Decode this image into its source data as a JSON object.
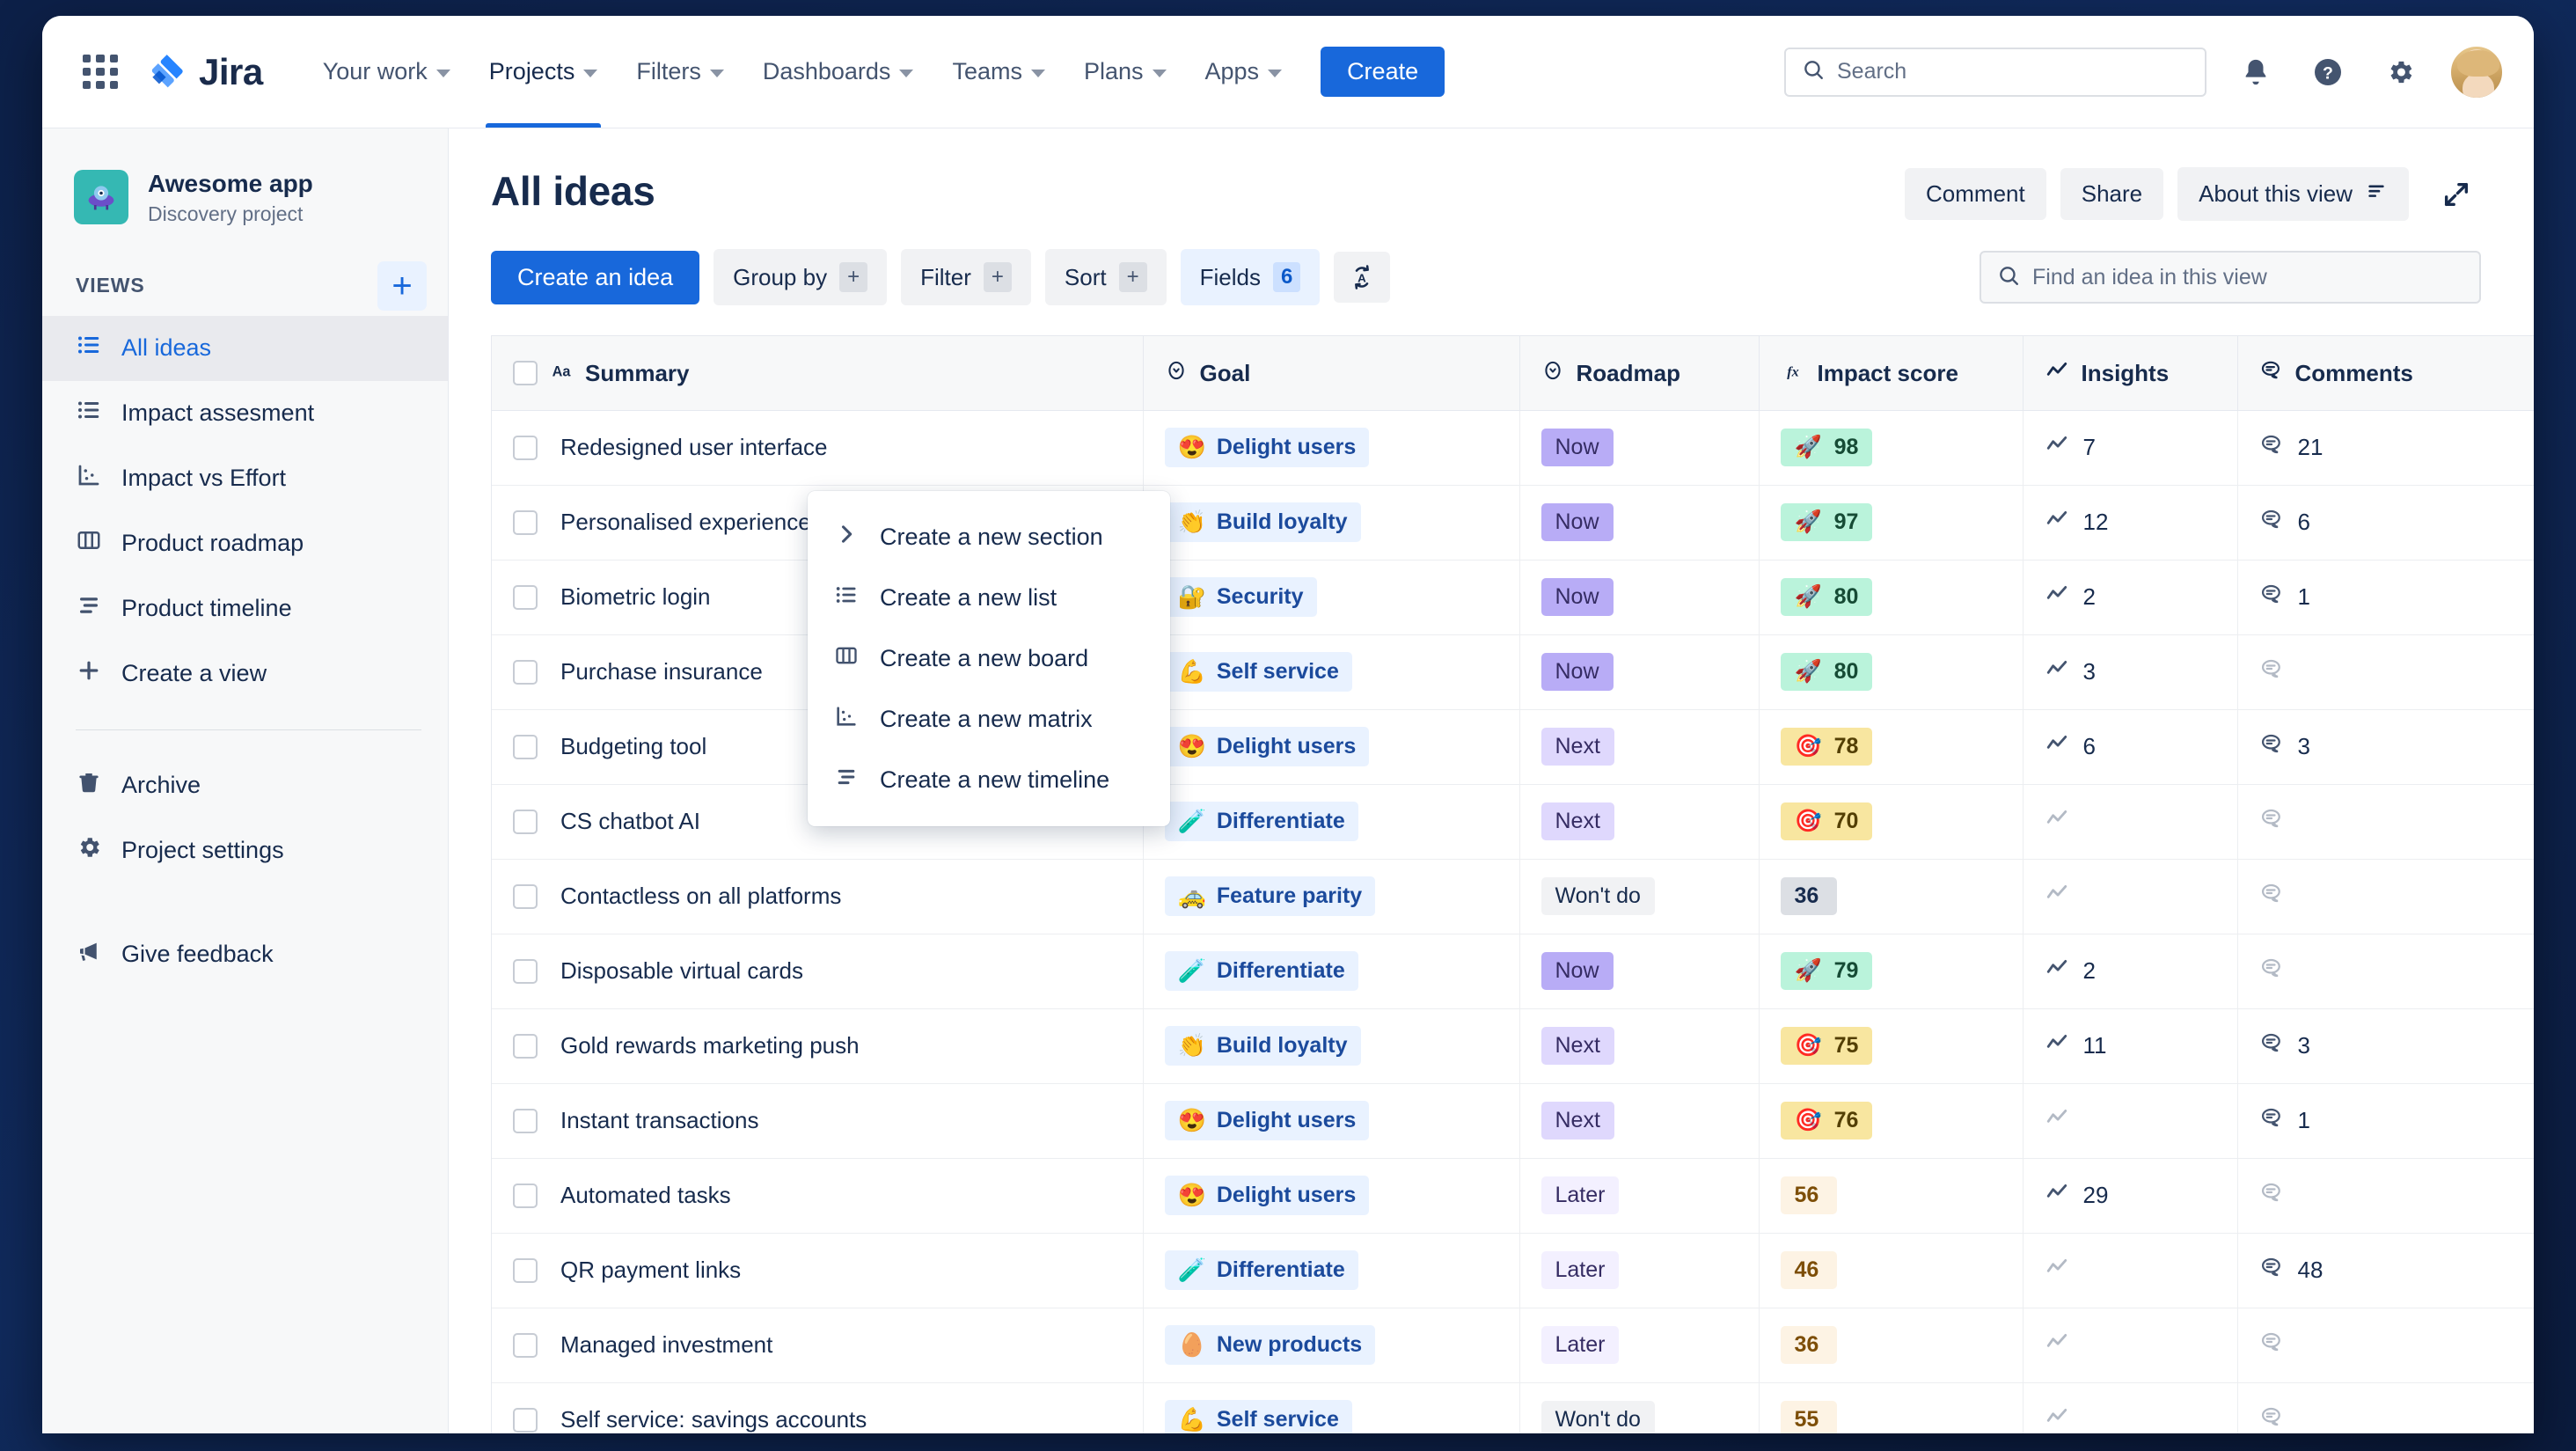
{
  "topnav": {
    "brand": "Jira",
    "items": [
      {
        "label": "Your work",
        "has_caret": true,
        "active": false
      },
      {
        "label": "Projects",
        "has_caret": true,
        "active": true
      },
      {
        "label": "Filters",
        "has_caret": true,
        "active": false
      },
      {
        "label": "Dashboards",
        "has_caret": true,
        "active": false
      },
      {
        "label": "Teams",
        "has_caret": true,
        "active": false
      },
      {
        "label": "Plans",
        "has_caret": true,
        "active": false
      },
      {
        "label": "Apps",
        "has_caret": true,
        "active": false
      }
    ],
    "create_label": "Create",
    "search_placeholder": "Search",
    "icons": [
      "app-switcher-icon",
      "search-icon",
      "notifications-icon",
      "help-icon",
      "settings-icon",
      "avatar"
    ]
  },
  "sidebar": {
    "project_name": "Awesome app",
    "project_type": "Discovery project",
    "section_label": "VIEWS",
    "add_view_label": "+",
    "views": [
      {
        "label": "All ideas",
        "icon": "list-icon",
        "selected": true
      },
      {
        "label": "Impact assesment",
        "icon": "list-icon",
        "selected": false
      },
      {
        "label": "Impact vs Effort",
        "icon": "matrix-icon",
        "selected": false
      },
      {
        "label": "Product roadmap",
        "icon": "board-icon",
        "selected": false
      },
      {
        "label": "Product timeline",
        "icon": "timeline-icon",
        "selected": false
      },
      {
        "label": "Create a view",
        "icon": "plus-icon",
        "selected": false
      }
    ],
    "footer": [
      {
        "label": "Archive",
        "icon": "trash-icon"
      },
      {
        "label": "Project settings",
        "icon": "gear-icon"
      },
      {
        "label": "Give feedback",
        "icon": "megaphone-icon"
      }
    ]
  },
  "popup": {
    "items": [
      {
        "label": "Create a new section",
        "icon": "chevron-right-icon"
      },
      {
        "label": "Create a new list",
        "icon": "list-icon"
      },
      {
        "label": "Create a new board",
        "icon": "board-icon"
      },
      {
        "label": "Create a new matrix",
        "icon": "matrix-icon"
      },
      {
        "label": "Create a new timeline",
        "icon": "timeline-icon"
      }
    ]
  },
  "main": {
    "title": "All ideas",
    "header_actions": [
      {
        "label": "Comment",
        "icon": null
      },
      {
        "label": "Share",
        "icon": null
      },
      {
        "label": "About this view",
        "icon": "detail-lines-icon"
      }
    ],
    "expand_icon": "expand-icon",
    "toolbar": {
      "create_idea": "Create an idea",
      "group_by": "Group by",
      "group_by_badge": "+",
      "filter": "Filter",
      "filter_badge": "+",
      "sort": "Sort",
      "sort_badge": "+",
      "fields": "Fields",
      "fields_badge": "6",
      "autosort_icon": "auto-sort-a-icon",
      "find_placeholder": "Find an idea in this view"
    },
    "table": {
      "columns": [
        {
          "label": "Summary",
          "icon": "text-field-icon"
        },
        {
          "label": "Goal",
          "icon": "select-field-icon"
        },
        {
          "label": "Roadmap",
          "icon": "select-field-icon"
        },
        {
          "label": "Impact score",
          "icon": "formula-icon"
        },
        {
          "label": "Insights",
          "icon": "insights-icon"
        },
        {
          "label": "Comments",
          "icon": "comment-icon"
        }
      ],
      "add_column_label": "+",
      "rows": [
        {
          "summary": "Redesigned user interface",
          "summary_visible": "user interface",
          "goal": "Delight users",
          "goal_emoji": "😍",
          "roadmap": "Now",
          "roadmap_style": "now",
          "score": "98",
          "score_style": "green",
          "score_emoji": "🚀",
          "insights": "7",
          "comments": "21"
        },
        {
          "summary": "Personalised experiences",
          "summary_visible": "experiences",
          "goal": "Build loyalty",
          "goal_emoji": "👏",
          "roadmap": "Now",
          "roadmap_style": "now",
          "score": "97",
          "score_style": "green",
          "score_emoji": "🚀",
          "insights": "12",
          "comments": "6"
        },
        {
          "summary": "Biometric login",
          "summary_visible": "",
          "goal": "Security",
          "goal_emoji": "🔐",
          "roadmap": "Now",
          "roadmap_style": "now",
          "score": "80",
          "score_style": "green",
          "score_emoji": "🚀",
          "insights": "2",
          "comments": "1"
        },
        {
          "summary": "Purchase insurance",
          "summary_visible": "insurance",
          "goal": "Self service",
          "goal_emoji": "💪",
          "roadmap": "Now",
          "roadmap_style": "now",
          "score": "80",
          "score_style": "green",
          "score_emoji": "🚀",
          "insights": "3",
          "comments": ""
        },
        {
          "summary": "Budgeting tool",
          "summary_visible": "Budgeting tool",
          "goal": "Delight users",
          "goal_emoji": "😍",
          "roadmap": "Next",
          "roadmap_style": "next",
          "score": "78",
          "score_style": "yellow",
          "score_emoji": "🎯",
          "insights": "6",
          "comments": "3"
        },
        {
          "summary": "CS chatbot AI",
          "summary_visible": "CS chatbot AI",
          "goal": "Differentiate",
          "goal_emoji": "🧪",
          "roadmap": "Next",
          "roadmap_style": "next",
          "score": "70",
          "score_style": "yellow",
          "score_emoji": "🎯",
          "insights": "",
          "comments": ""
        },
        {
          "summary": "Contactless on all platforms",
          "summary_visible": "Contactless on all platforms",
          "goal": "Feature parity",
          "goal_emoji": "🚕",
          "roadmap": "Won't do",
          "roadmap_style": "wont",
          "score": "36",
          "score_style": "grey",
          "score_emoji": "",
          "insights": "",
          "comments": ""
        },
        {
          "summary": "Disposable virtual cards",
          "summary_visible": "Disposable virtual cards",
          "goal": "Differentiate",
          "goal_emoji": "🧪",
          "roadmap": "Now",
          "roadmap_style": "now",
          "score": "79",
          "score_style": "green",
          "score_emoji": "🚀",
          "insights": "2",
          "comments": ""
        },
        {
          "summary": "Gold rewards marketing push",
          "summary_visible": "Gold rewards marketing push",
          "goal": "Build loyalty",
          "goal_emoji": "👏",
          "roadmap": "Next",
          "roadmap_style": "next",
          "score": "75",
          "score_style": "yellow",
          "score_emoji": "🎯",
          "insights": "11",
          "comments": "3"
        },
        {
          "summary": "Instant transactions",
          "summary_visible": "Instant transactions",
          "goal": "Delight users",
          "goal_emoji": "😍",
          "roadmap": "Next",
          "roadmap_style": "next",
          "score": "76",
          "score_style": "yellow",
          "score_emoji": "🎯",
          "insights": "",
          "comments": "1"
        },
        {
          "summary": "Automated tasks",
          "summary_visible": "Automated tasks",
          "goal": "Delight users",
          "goal_emoji": "😍",
          "roadmap": "Later",
          "roadmap_style": "later",
          "score": "56",
          "score_style": "cream",
          "score_emoji": "",
          "insights": "29",
          "comments": ""
        },
        {
          "summary": "QR payment links",
          "summary_visible": "QR payment links",
          "goal": "Differentiate",
          "goal_emoji": "🧪",
          "roadmap": "Later",
          "roadmap_style": "later",
          "score": "46",
          "score_style": "cream",
          "score_emoji": "",
          "insights": "",
          "comments": "48"
        },
        {
          "summary": "Managed investment",
          "summary_visible": "Managed investment",
          "goal": "New products",
          "goal_emoji": "🥚",
          "roadmap": "Later",
          "roadmap_style": "later",
          "score": "36",
          "score_style": "cream",
          "score_emoji": "",
          "insights": "",
          "comments": ""
        },
        {
          "summary": "Self service: savings accounts",
          "summary_visible": "Self service: savings accounts",
          "goal": "Self service",
          "goal_emoji": "💪",
          "roadmap": "Won't do",
          "roadmap_style": "wont",
          "score": "55",
          "score_style": "cream",
          "score_emoji": "",
          "insights": "",
          "comments": ""
        }
      ]
    }
  },
  "colors": {
    "brand_blue": "#1868db",
    "text": "#172b4d",
    "subtle_text": "#626f86",
    "now_purple": "#b8acf6",
    "score_green": "#baf3db",
    "score_yellow": "#f8e6a0",
    "tag_blue": "#e9f2ff"
  }
}
